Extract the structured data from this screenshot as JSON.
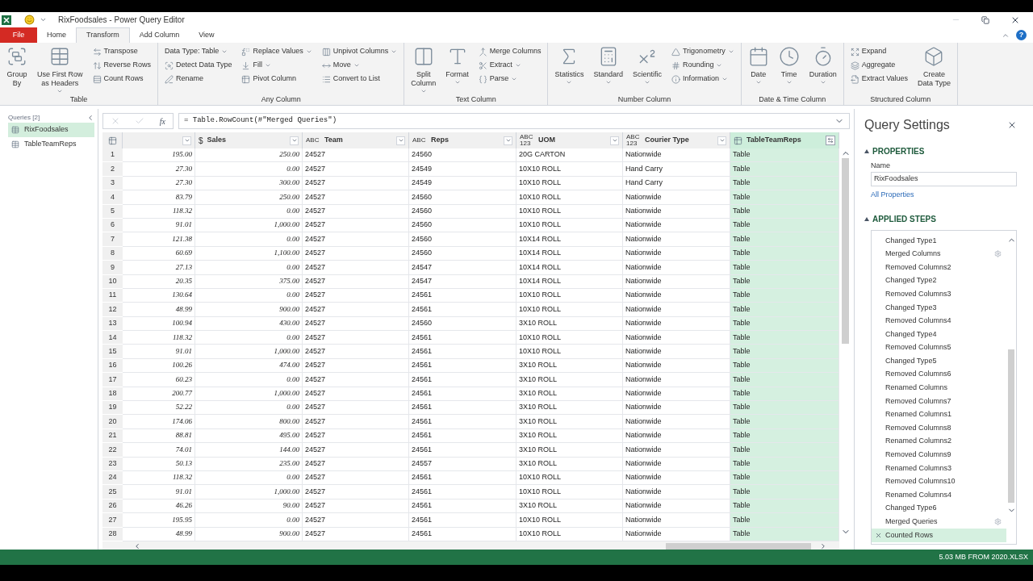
{
  "window": {
    "title": "RixFoodsales - Power Query Editor",
    "help": "?"
  },
  "tabs": [
    {
      "label": "File",
      "kind": "file",
      "selected": false
    },
    {
      "label": "Home",
      "kind": "tab",
      "selected": false
    },
    {
      "label": "Transform",
      "kind": "tab",
      "selected": true
    },
    {
      "label": "Add Column",
      "kind": "tab",
      "selected": false
    },
    {
      "label": "View",
      "kind": "tab",
      "selected": false
    }
  ],
  "ribbon": [
    {
      "label": "Table",
      "columns": [
        {
          "kind": "large",
          "lines": [
            "Group",
            "By"
          ],
          "dropdown": false
        },
        {
          "kind": "large",
          "lines": [
            "Use First Row",
            "as Headers"
          ],
          "dropdown": true
        },
        {
          "kind": "stack",
          "items": [
            {
              "label": "Transpose",
              "dropdown": false
            },
            {
              "label": "Reverse Rows",
              "dropdown": false
            },
            {
              "label": "Count Rows",
              "dropdown": false
            }
          ]
        }
      ]
    },
    {
      "label": "Any Column",
      "columns": [
        {
          "kind": "stack",
          "items": [
            {
              "label": "Data Type: Table",
              "dropdown": true
            },
            {
              "label": "Detect Data Type",
              "dropdown": false
            },
            {
              "label": "Rename",
              "dropdown": false
            }
          ]
        },
        {
          "kind": "stack",
          "items": [
            {
              "label": "Replace Values",
              "dropdown": true
            },
            {
              "label": "Fill",
              "dropdown": true
            },
            {
              "label": "Pivot Column",
              "dropdown": false
            }
          ]
        },
        {
          "kind": "stack",
          "items": [
            {
              "label": "Unpivot Columns",
              "dropdown": true
            },
            {
              "label": "Move",
              "dropdown": true
            },
            {
              "label": "Convert to List",
              "dropdown": false
            }
          ]
        }
      ]
    },
    {
      "label": "Text Column",
      "columns": [
        {
          "kind": "large",
          "lines": [
            "Split",
            "Column"
          ],
          "dropdown": true
        },
        {
          "kind": "large",
          "lines": [
            "Format"
          ],
          "dropdown": true
        },
        {
          "kind": "stack",
          "items": [
            {
              "label": "Merge Columns",
              "dropdown": false
            },
            {
              "label": "Extract",
              "dropdown": true
            },
            {
              "label": "Parse",
              "dropdown": true
            }
          ]
        }
      ]
    },
    {
      "label": "Number Column",
      "columns": [
        {
          "kind": "large",
          "lines": [
            "Statistics"
          ],
          "dropdown": true
        },
        {
          "kind": "large",
          "lines": [
            "Standard"
          ],
          "dropdown": true
        },
        {
          "kind": "large",
          "lines": [
            "Scientific"
          ],
          "dropdown": true
        },
        {
          "kind": "stack",
          "items": [
            {
              "label": "Trigonometry",
              "dropdown": true
            },
            {
              "label": "Rounding",
              "dropdown": true
            },
            {
              "label": "Information",
              "dropdown": true
            }
          ]
        }
      ]
    },
    {
      "label": "Date & Time Column",
      "columns": [
        {
          "kind": "large",
          "lines": [
            "Date"
          ],
          "dropdown": true
        },
        {
          "kind": "large",
          "lines": [
            "Time"
          ],
          "dropdown": true
        },
        {
          "kind": "large",
          "lines": [
            "Duration"
          ],
          "dropdown": true
        }
      ]
    },
    {
      "label": "Structured Column",
      "columns": [
        {
          "kind": "stack",
          "items": [
            {
              "label": "Expand",
              "dropdown": false
            },
            {
              "label": "Aggregate",
              "dropdown": false
            },
            {
              "label": "Extract Values",
              "dropdown": false
            }
          ]
        },
        {
          "kind": "large",
          "lines": [
            "Create",
            "Data Type"
          ],
          "dropdown": false
        }
      ]
    }
  ],
  "queries": {
    "title": "Queries [2]",
    "items": [
      {
        "label": "RixFoodsales",
        "selected": true
      },
      {
        "label": "TableTeamReps",
        "selected": false
      }
    ]
  },
  "formula_bar": {
    "fx": "fx",
    "formula": "= Table.RowCount(#\"Merged Queries\")"
  },
  "table": {
    "columns": [
      {
        "kind": "decimal"
      },
      {
        "kind": "currency",
        "label": "Sales",
        "type_glyph": "$"
      },
      {
        "kind": "text",
        "label": "Team",
        "type_glyph": "ABC"
      },
      {
        "kind": "text",
        "label": "Reps",
        "type_glyph": "ABC"
      },
      {
        "kind": "any",
        "label": "UOM",
        "type_glyph": "ABC 123"
      },
      {
        "kind": "any",
        "label": "Courier Type",
        "type_glyph": "ABC 123"
      },
      {
        "kind": "table",
        "label": "TableTeamReps"
      }
    ],
    "rows": [
      {
        "number": "1",
        "cells": [
          "195.00",
          "250.00",
          "24527",
          "24560",
          "20G CARTON",
          "Nationwide",
          "Table"
        ]
      },
      {
        "number": "2",
        "cells": [
          "27.30",
          "0.00",
          "24527",
          "24549",
          "10X10 ROLL",
          "Hand Carry",
          "Table"
        ]
      },
      {
        "number": "3",
        "cells": [
          "27.30",
          "300.00",
          "24527",
          "24549",
          "10X10 ROLL",
          "Hand Carry",
          "Table"
        ]
      },
      {
        "number": "4",
        "cells": [
          "83.79",
          "250.00",
          "24527",
          "24560",
          "10X10 ROLL",
          "Nationwide",
          "Table"
        ]
      },
      {
        "number": "5",
        "cells": [
          "118.32",
          "0.00",
          "24527",
          "24560",
          "10X10 ROLL",
          "Nationwide",
          "Table"
        ]
      },
      {
        "number": "6",
        "cells": [
          "91.01",
          "1,000.00",
          "24527",
          "24560",
          "10X10 ROLL",
          "Nationwide",
          "Table"
        ]
      },
      {
        "number": "7",
        "cells": [
          "121.38",
          "0.00",
          "24527",
          "24560",
          "10X14 ROLL",
          "Nationwide",
          "Table"
        ]
      },
      {
        "number": "8",
        "cells": [
          "60.69",
          "1,100.00",
          "24527",
          "24560",
          "10X14 ROLL",
          "Nationwide",
          "Table"
        ]
      },
      {
        "number": "9",
        "cells": [
          "27.13",
          "0.00",
          "24527",
          "24547",
          "10X14 ROLL",
          "Nationwide",
          "Table"
        ]
      },
      {
        "number": "10",
        "cells": [
          "20.35",
          "375.00",
          "24527",
          "24547",
          "10X14 ROLL",
          "Nationwide",
          "Table"
        ]
      },
      {
        "number": "11",
        "cells": [
          "130.64",
          "0.00",
          "24527",
          "24561",
          "10X10 ROLL",
          "Nationwide",
          "Table"
        ]
      },
      {
        "number": "12",
        "cells": [
          "48.99",
          "900.00",
          "24527",
          "24561",
          "10X10 ROLL",
          "Nationwide",
          "Table"
        ]
      },
      {
        "number": "13",
        "cells": [
          "100.94",
          "430.00",
          "24527",
          "24560",
          "3X10 ROLL",
          "Nationwide",
          "Table"
        ]
      },
      {
        "number": "14",
        "cells": [
          "118.32",
          "0.00",
          "24527",
          "24561",
          "10X10 ROLL",
          "Nationwide",
          "Table"
        ]
      },
      {
        "number": "15",
        "cells": [
          "91.01",
          "1,000.00",
          "24527",
          "24561",
          "10X10 ROLL",
          "Nationwide",
          "Table"
        ]
      },
      {
        "number": "16",
        "cells": [
          "100.26",
          "474.00",
          "24527",
          "24561",
          "3X10 ROLL",
          "Nationwide",
          "Table"
        ]
      },
      {
        "number": "17",
        "cells": [
          "60.23",
          "0.00",
          "24527",
          "24561",
          "3X10 ROLL",
          "Nationwide",
          "Table"
        ]
      },
      {
        "number": "18",
        "cells": [
          "200.77",
          "1,000.00",
          "24527",
          "24561",
          "3X10 ROLL",
          "Nationwide",
          "Table"
        ]
      },
      {
        "number": "19",
        "cells": [
          "52.22",
          "0.00",
          "24527",
          "24561",
          "3X10 ROLL",
          "Nationwide",
          "Table"
        ]
      },
      {
        "number": "20",
        "cells": [
          "174.06",
          "800.00",
          "24527",
          "24561",
          "3X10 ROLL",
          "Nationwide",
          "Table"
        ]
      },
      {
        "number": "21",
        "cells": [
          "88.81",
          "495.00",
          "24527",
          "24561",
          "3X10 ROLL",
          "Nationwide",
          "Table"
        ]
      },
      {
        "number": "22",
        "cells": [
          "74.01",
          "144.00",
          "24527",
          "24561",
          "3X10 ROLL",
          "Nationwide",
          "Table"
        ]
      },
      {
        "number": "23",
        "cells": [
          "50.13",
          "235.00",
          "24527",
          "24557",
          "3X10 ROLL",
          "Nationwide",
          "Table"
        ]
      },
      {
        "number": "24",
        "cells": [
          "118.32",
          "0.00",
          "24527",
          "24561",
          "10X10 ROLL",
          "Nationwide",
          "Table"
        ]
      },
      {
        "number": "25",
        "cells": [
          "91.01",
          "1,000.00",
          "24527",
          "24561",
          "10X10 ROLL",
          "Nationwide",
          "Table"
        ]
      },
      {
        "number": "26",
        "cells": [
          "46.26",
          "90.00",
          "24527",
          "24561",
          "3X10 ROLL",
          "Nationwide",
          "Table"
        ]
      },
      {
        "number": "27",
        "cells": [
          "195.95",
          "0.00",
          "24527",
          "24561",
          "10X10 ROLL",
          "Nationwide",
          "Table"
        ]
      },
      {
        "number": "28",
        "cells": [
          "48.99",
          "900.00",
          "24527",
          "24561",
          "10X10 ROLL",
          "Nationwide",
          "Table"
        ]
      }
    ]
  },
  "settings": {
    "title": "Query Settings",
    "properties_heading": "PROPERTIES",
    "name_label": "Name",
    "name_value": "RixFoodsales",
    "all_properties": "All Properties",
    "steps_heading": "APPLIED STEPS",
    "steps": [
      {
        "label": "Changed Type1",
        "has_settings": false,
        "selected": false
      },
      {
        "label": "Merged Columns",
        "has_settings": true,
        "selected": false
      },
      {
        "label": "Removed Columns2",
        "has_settings": false,
        "selected": false
      },
      {
        "label": "Changed Type2",
        "has_settings": false,
        "selected": false
      },
      {
        "label": "Removed Columns3",
        "has_settings": false,
        "selected": false
      },
      {
        "label": "Changed Type3",
        "has_settings": false,
        "selected": false
      },
      {
        "label": "Removed Columns4",
        "has_settings": false,
        "selected": false
      },
      {
        "label": "Changed Type4",
        "has_settings": false,
        "selected": false
      },
      {
        "label": "Removed Columns5",
        "has_settings": false,
        "selected": false
      },
      {
        "label": "Changed Type5",
        "has_settings": false,
        "selected": false
      },
      {
        "label": "Removed Columns6",
        "has_settings": false,
        "selected": false
      },
      {
        "label": "Renamed Columns",
        "has_settings": false,
        "selected": false
      },
      {
        "label": "Removed Columns7",
        "has_settings": false,
        "selected": false
      },
      {
        "label": "Renamed Columns1",
        "has_settings": false,
        "selected": false
      },
      {
        "label": "Removed Columns8",
        "has_settings": false,
        "selected": false
      },
      {
        "label": "Renamed Columns2",
        "has_settings": false,
        "selected": false
      },
      {
        "label": "Removed Columns9",
        "has_settings": false,
        "selected": false
      },
      {
        "label": "Renamed Columns3",
        "has_settings": false,
        "selected": false
      },
      {
        "label": "Removed Columns10",
        "has_settings": false,
        "selected": false
      },
      {
        "label": "Renamed Columns4",
        "has_settings": false,
        "selected": false
      },
      {
        "label": "Changed Type6",
        "has_settings": false,
        "selected": false
      },
      {
        "label": "Merged Queries",
        "has_settings": true,
        "selected": false
      },
      {
        "label": "Counted Rows",
        "has_settings": false,
        "selected": true
      }
    ]
  },
  "status_bar": {
    "text": "5.03 MB FROM 2020.XLSX"
  }
}
